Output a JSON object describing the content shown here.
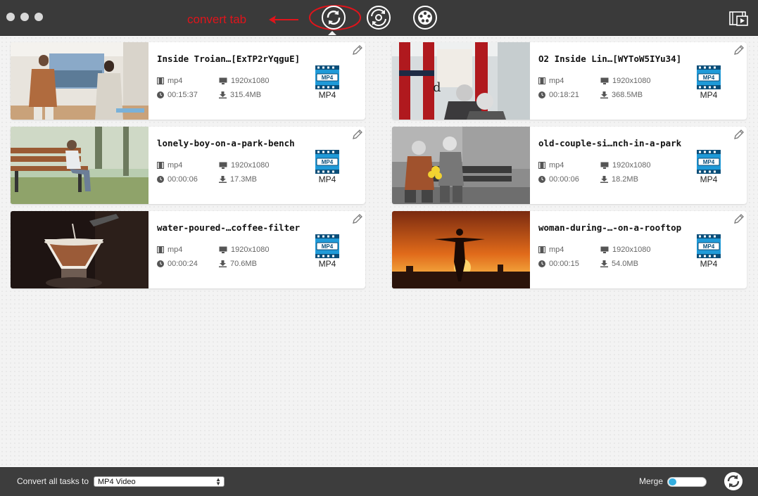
{
  "annotation": {
    "text": "convert tab",
    "color": "#e0141b"
  },
  "toolbar": {
    "tabs": [
      {
        "name": "convert-tab-icon",
        "active": true
      },
      {
        "name": "rip-tab-icon",
        "active": false
      },
      {
        "name": "toolbox-tab-icon",
        "active": false
      }
    ],
    "right_icon": "media-browser-icon"
  },
  "tasks": [
    {
      "title": "Inside Troian…[ExTP2rYqguE]",
      "format": "mp4",
      "resolution": "1920x1080",
      "duration": "00:15:37",
      "size": "315.4MB",
      "target_format": "MP4"
    },
    {
      "title": "O2 Inside Lin…[WYToW5IYu34]",
      "format": "mp4",
      "resolution": "1920x1080",
      "duration": "00:18:21",
      "size": "368.5MB",
      "target_format": "MP4"
    },
    {
      "title": "lonely-boy-on-a-park-bench",
      "format": "mp4",
      "resolution": "1920x1080",
      "duration": "00:00:06",
      "size": "17.3MB",
      "target_format": "MP4"
    },
    {
      "title": "old-couple-si…nch-in-a-park",
      "format": "mp4",
      "resolution": "1920x1080",
      "duration": "00:00:06",
      "size": "18.2MB",
      "target_format": "MP4"
    },
    {
      "title": "water-poured-…coffee-filter",
      "format": "mp4",
      "resolution": "1920x1080",
      "duration": "00:00:24",
      "size": "70.6MB",
      "target_format": "MP4"
    },
    {
      "title": "woman-during-…-on-a-rooftop",
      "format": "mp4",
      "resolution": "1920x1080",
      "duration": "00:00:15",
      "size": "54.0MB",
      "target_format": "MP4"
    }
  ],
  "bottom": {
    "convert_all_label": "Convert all tasks to",
    "selected_format": "MP4 Video",
    "merge_label": "Merge",
    "merge_on": false
  },
  "colors": {
    "titlebar": "#3a3a3a",
    "accent": "#33aee0",
    "badge": "#1f9ad8"
  }
}
